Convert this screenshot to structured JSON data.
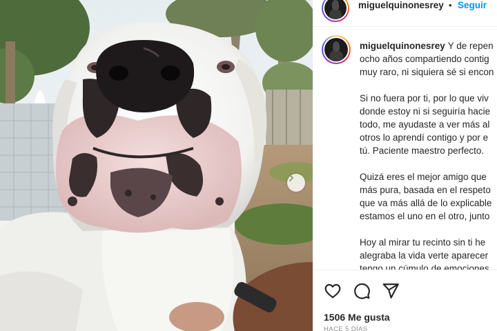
{
  "post": {
    "username": "miguelquinonesrey",
    "dot": "•",
    "follow_label": "Seguir",
    "caption_lines": [
      [
        "Y de repen",
        "ocho años compartiendo contig",
        "muy raro, ni siquiera sé si encon"
      ],
      [
        "Si no fuera por ti, por lo que viv",
        "donde estoy ni si seguiría hacie",
        "todo, me ayudaste a ver más al",
        "otros lo aprendí contigo y por e",
        "tú. Paciente maestro perfecto."
      ],
      [
        "Quizá eres el mejor amigo que",
        "más pura, basada en el respeto",
        "que va más allá de lo explicable",
        "estamos el uno en el otro, junto"
      ],
      [
        "Hoy al mirar tu recinto sin ti he",
        "alegraba la vida verte aparecer",
        "tengo un cúmulo de emociones"
      ]
    ],
    "likes": "1506 Me gusta",
    "time_ago": "HACE 5 DÍAS"
  },
  "icons": {
    "like": "heart-outline-icon",
    "comment": "comment-bubble-icon",
    "share": "paper-plane-icon",
    "next": "chevron-right-icon"
  },
  "colors": {
    "accent": "#0095f6",
    "text": "#262626",
    "muted": "#8e8e8e",
    "divider": "#efefef"
  }
}
